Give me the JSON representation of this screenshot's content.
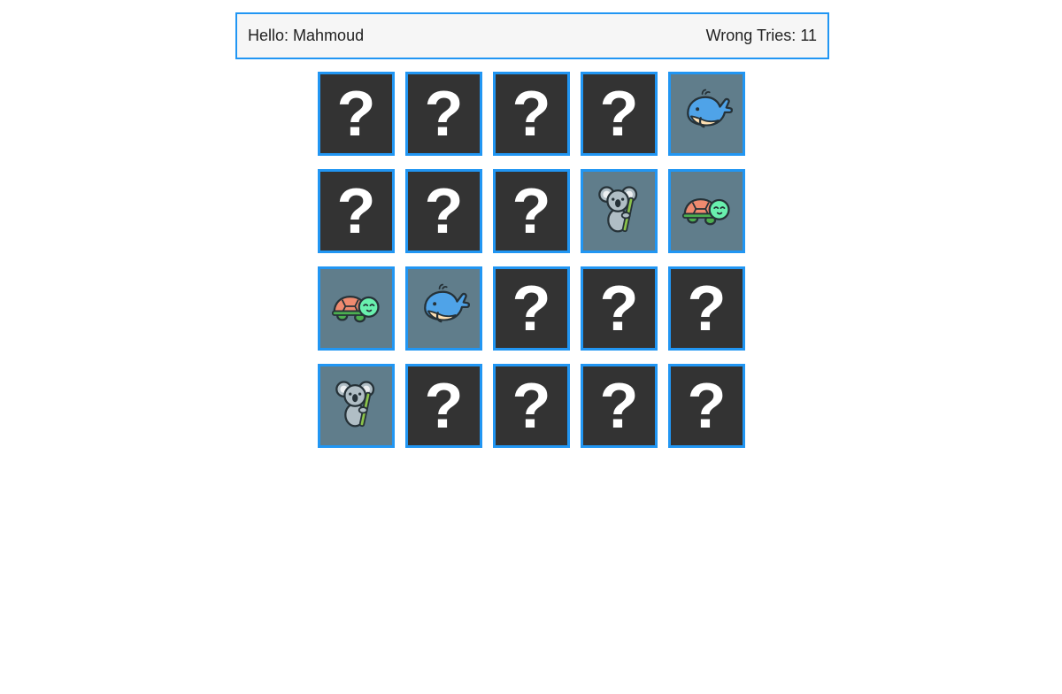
{
  "header": {
    "greeting_label": "Hello:",
    "player_name": "Mahmoud",
    "wrong_tries_label": "Wrong Tries:",
    "wrong_tries": "11"
  },
  "colors": {
    "accent": "#2196f3",
    "hidden_card": "#333333",
    "flipped_card": "#607d8b",
    "header_bg": "#f6f6f6"
  },
  "board": {
    "hidden_symbol": "?",
    "cards": [
      {
        "state": "hidden"
      },
      {
        "state": "hidden"
      },
      {
        "state": "hidden"
      },
      {
        "state": "hidden"
      },
      {
        "state": "flipped",
        "animal": "whale"
      },
      {
        "state": "hidden"
      },
      {
        "state": "hidden"
      },
      {
        "state": "hidden"
      },
      {
        "state": "flipped",
        "animal": "koala"
      },
      {
        "state": "flipped",
        "animal": "turtle"
      },
      {
        "state": "flipped",
        "animal": "turtle"
      },
      {
        "state": "flipped",
        "animal": "whale"
      },
      {
        "state": "hidden"
      },
      {
        "state": "hidden"
      },
      {
        "state": "hidden"
      },
      {
        "state": "flipped",
        "animal": "koala"
      },
      {
        "state": "hidden"
      },
      {
        "state": "hidden"
      },
      {
        "state": "hidden"
      },
      {
        "state": "hidden"
      }
    ]
  }
}
